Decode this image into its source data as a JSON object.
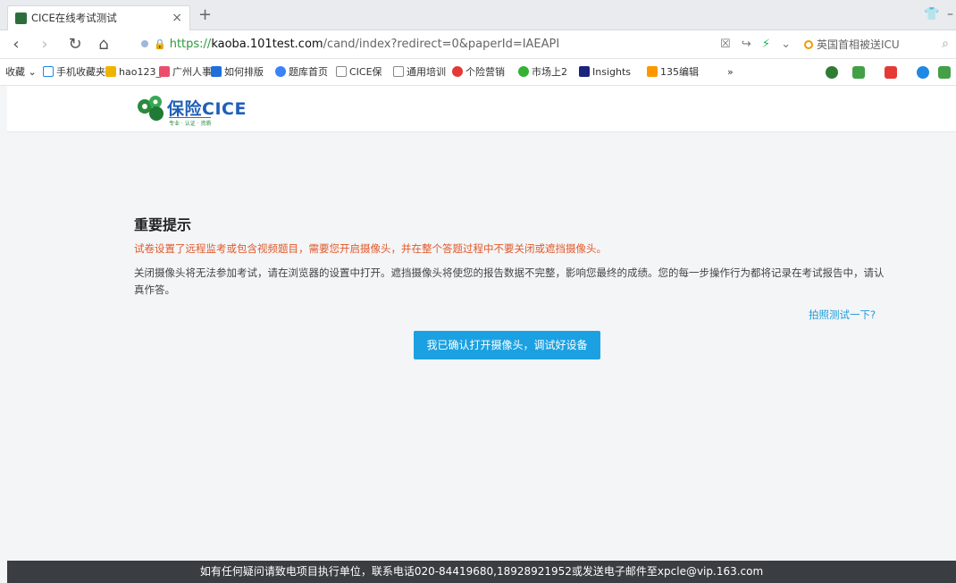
{
  "browser": {
    "tab_title": "CICE在线考试测试",
    "tab_close": "×",
    "new_tab": "+",
    "url_https": "https://",
    "url_domain": "kaoba.101test.com",
    "url_path": "/cand/index?redirect=0&paperId=IAEAPI",
    "search_engine_label": "英国首相被送ICU",
    "bookmarks": [
      "收藏",
      "手机收藏夹",
      "hao123_",
      "广州人事",
      "如何排版",
      "题库首页",
      "CICE保",
      "通用培训",
      "个险营销",
      "市场上2",
      "Insights",
      "135编辑",
      "»"
    ],
    "colors": {
      "accent": "#1ba1e2",
      "warning": "#e05a2b",
      "link": "#1d9bd8",
      "footer_bg": "#3a3d42",
      "logo_blue": "#1f5fb8",
      "logo_green": "#2a8a3e"
    }
  },
  "site": {
    "logo_text": "保险CICE",
    "logo_tagline": "专业 · 认证 · 资质"
  },
  "notice": {
    "title": "重要提示",
    "warning": "试卷设置了远程监考或包含视频题目，需要您开启摄像头，并在整个答题过程中不要关闭或遮挡摄像头。",
    "body": "关闭摄像头将无法参加考试，请在浏览器的设置中打开。遮挡摄像头将使您的报告数据不完整，影响您最终的成绩。您的每一步操作行为都将记录在考试报告中，请认真作答。",
    "test_link": "拍照测试一下?",
    "confirm_button": "我已确认打开摄像头，调试好设备"
  },
  "footer": {
    "text": "如有任何疑问请致电项目执行单位，联系电话020-84419680,18928921952或发送电子邮件至xpcle@vip.163.com"
  }
}
